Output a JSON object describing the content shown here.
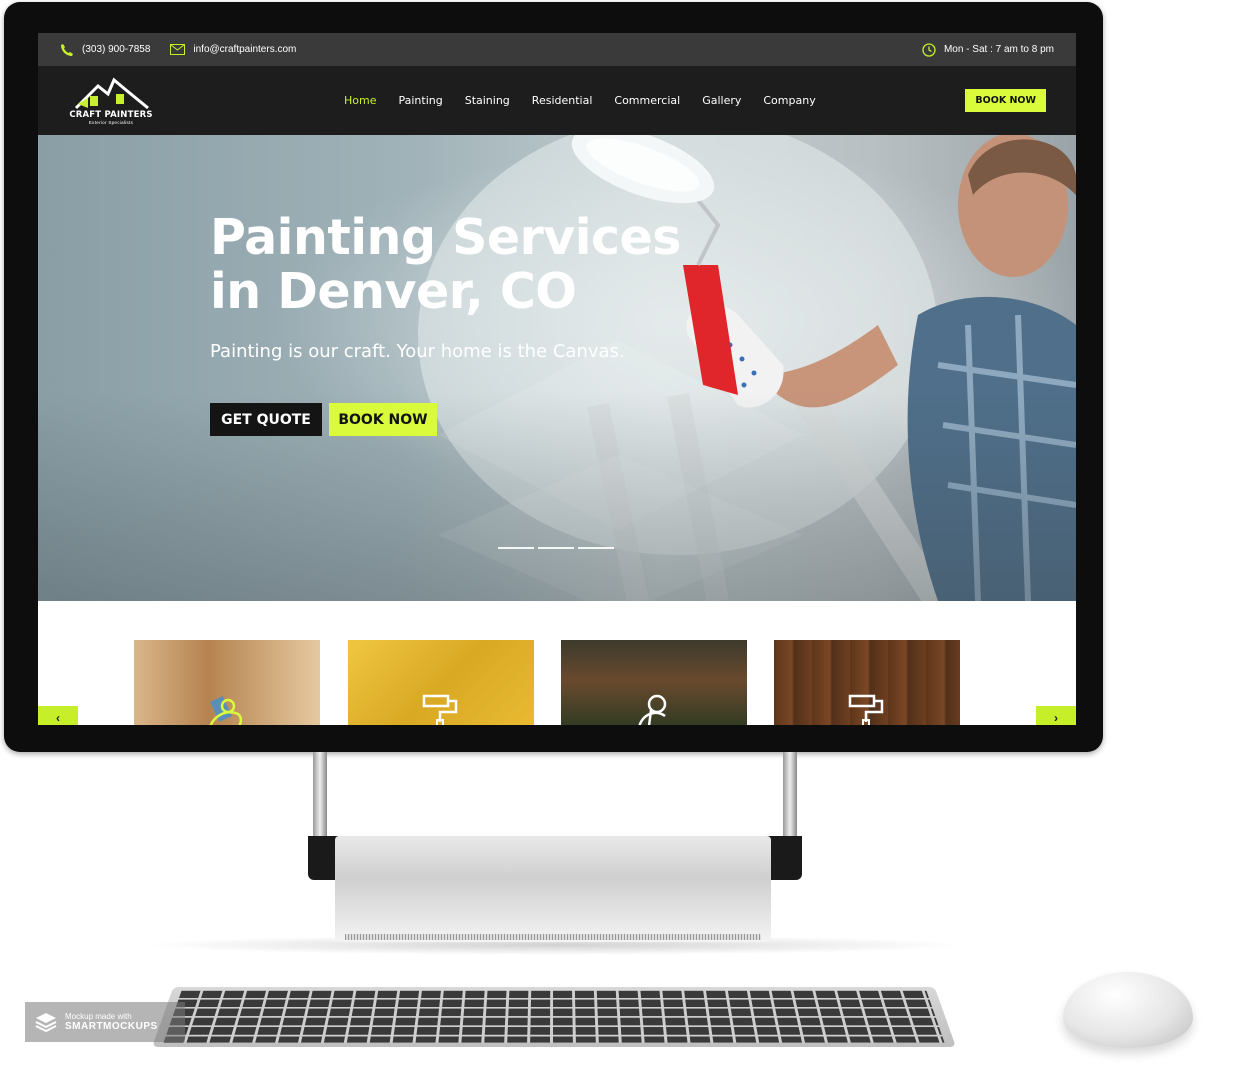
{
  "topbar": {
    "phone": "(303) 900-7858",
    "email": "info@craftpainters.com",
    "hours": "Mon - Sat : 7 am to 8 pm"
  },
  "brand": {
    "name": "CRAFT PAINTERS",
    "tagline": "Exterior Specialists",
    "accent_color": "#d9fb3c"
  },
  "nav": {
    "items": [
      "Home",
      "Painting",
      "Staining",
      "Residential",
      "Commercial",
      "Gallery",
      "Company"
    ],
    "active": "Home",
    "cta": "BOOK NOW"
  },
  "hero": {
    "title_line1": "Painting Services",
    "title_line2": "in Denver, CO",
    "subtitle": "Painting is our craft. Your home is the Canvas.",
    "primary_button": "GET QUOTE",
    "secondary_button": "BOOK NOW",
    "slides": 3
  },
  "services": {
    "cards": [
      {
        "icon": "paint-brush-icon",
        "bg": "#b98e5c"
      },
      {
        "icon": "paint-roller-icon",
        "bg": "#e5b62e"
      },
      {
        "icon": "paint-bucket-icon",
        "bg": "#5b4634"
      },
      {
        "icon": "paint-roller-icon",
        "bg": "#6b3e22"
      }
    ],
    "prev_icon": "chevron-left-icon",
    "next_icon": "chevron-right-icon"
  },
  "watermark": {
    "line1": "Mockup made with",
    "line2": "SMARTMOCKUPS"
  }
}
